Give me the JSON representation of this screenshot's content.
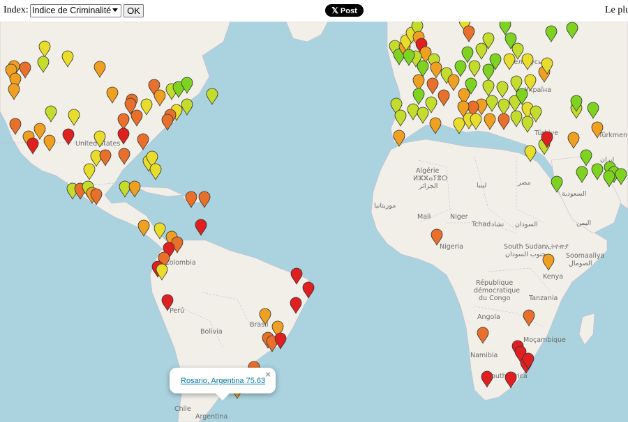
{
  "toolbar": {
    "index_label": "Index:",
    "index_selected": "Indice de Criminalité",
    "ok_label": "OK",
    "tweet_label": "Post",
    "right_text": "Le plu"
  },
  "popup": {
    "link_text": "Rosario, Argentina   75.63",
    "close_label": "×"
  },
  "map_labels": [
    "United States",
    "Algérie",
    "ⵍⵣⵣⴰⵢⴻⵔ",
    "الجزائر",
    "ليبيا",
    "مصر",
    "موريتانيا",
    "Mali",
    "Niger",
    "Tchad",
    "تشاد",
    "السودان",
    "Nigeria",
    "South Sudan",
    "جنوب السودان",
    "ኢትዮጵያ",
    "Soomaaliya",
    "الصومال",
    "Kenya",
    "République",
    "démocratique",
    "du Congo",
    "Tanzania",
    "Angola",
    "Namibia",
    "Moçambique",
    "South Africa",
    "Colombia",
    "Perú",
    "Bolivia",
    "Brasil",
    "Chile",
    "Argentina",
    "Türkiye",
    "ایران",
    "Türkmen",
    "السعودية",
    "اليمن",
    "Беларусь",
    "Україна"
  ],
  "colors": {
    "water": "#aad3df",
    "land": "#f2efe9",
    "green": "#7ed321",
    "yellowgreen": "#c4dc2c",
    "yellow": "#e8dd2a",
    "orange": "#f0a020",
    "darkorange": "#e8702a",
    "red": "#e02020"
  }
}
